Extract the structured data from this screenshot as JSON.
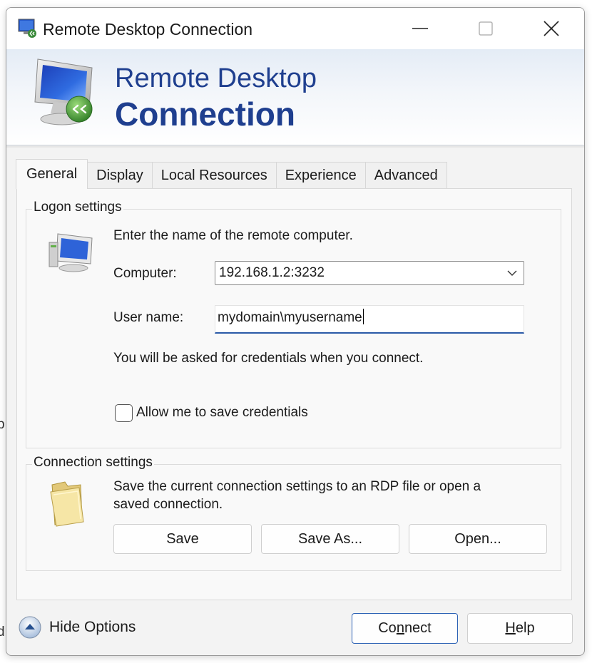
{
  "window": {
    "title": "Remote Desktop Connection",
    "controls": {
      "minimize": "—",
      "maximize": "☐",
      "close": "✕"
    }
  },
  "banner": {
    "line1": "Remote Desktop",
    "line2": "Connection"
  },
  "tabs": [
    "General",
    "Display",
    "Local Resources",
    "Experience",
    "Advanced"
  ],
  "active_tab": "General",
  "logon": {
    "legend": "Logon settings",
    "intro": "Enter the name of the remote computer.",
    "computer_label": "Computer:",
    "computer_value": "192.168.1.2:3232",
    "username_label": "User name:",
    "username_value": "mydomain\\myusername",
    "credentials_note": "You will be asked for credentials when you connect.",
    "save_credentials_label": "Allow me to save credentials",
    "save_credentials_checked": false
  },
  "connection": {
    "legend": "Connection settings",
    "description_line1": "Save the current connection settings to an RDP file or open a",
    "description_line2": "saved connection.",
    "buttons": {
      "save": "Save",
      "save_as": "Save As...",
      "open": "Open..."
    }
  },
  "footer": {
    "hide_options": "Hide Options",
    "connect": {
      "pre": "Co",
      "accel": "n",
      "post": "nect"
    },
    "help": {
      "accel": "H",
      "post": "elp"
    }
  },
  "stray_glyphs": [
    "p",
    "d"
  ],
  "colors": {
    "accent": "#1f3f8f",
    "focus": "#2b5aa8"
  }
}
